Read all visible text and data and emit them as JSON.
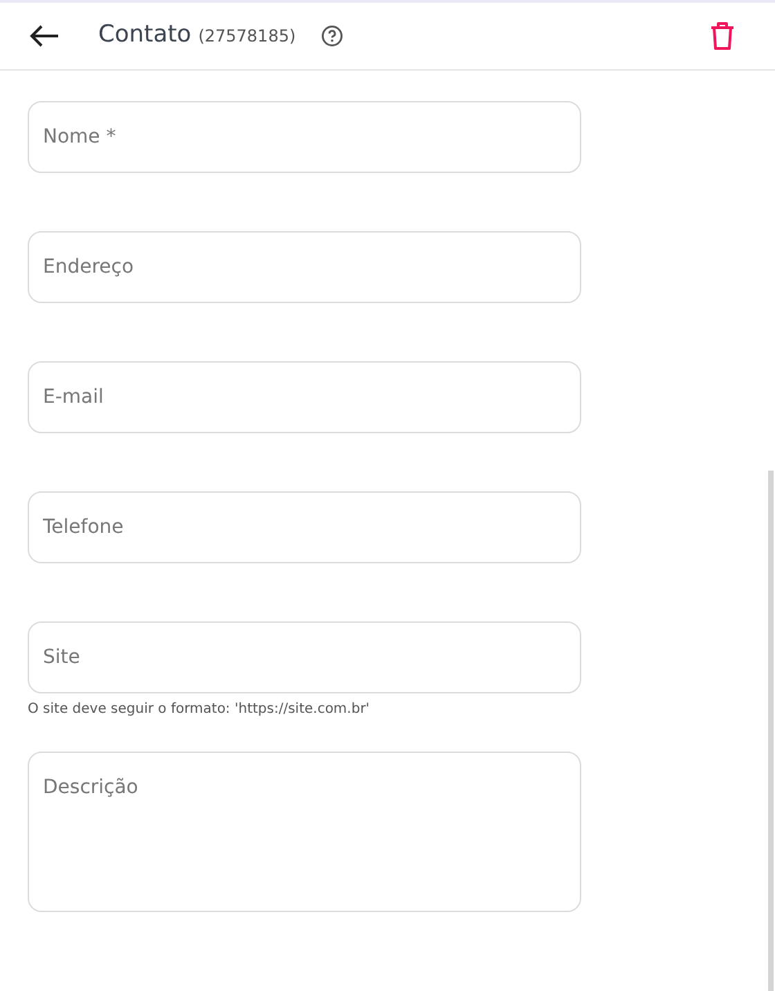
{
  "header": {
    "title": "Contato",
    "record_id": "(27578185)"
  },
  "fields": [
    {
      "kind": "input",
      "placeholder": "Nome *"
    },
    {
      "kind": "input",
      "placeholder": "Endereço"
    },
    {
      "kind": "input",
      "placeholder": "E-mail"
    },
    {
      "kind": "input",
      "placeholder": "Telefone"
    },
    {
      "kind": "input",
      "placeholder": "Site",
      "hint": "O site deve seguir o formato: 'https://site.com.br'"
    },
    {
      "kind": "textarea",
      "placeholder": "Descrição"
    }
  ]
}
